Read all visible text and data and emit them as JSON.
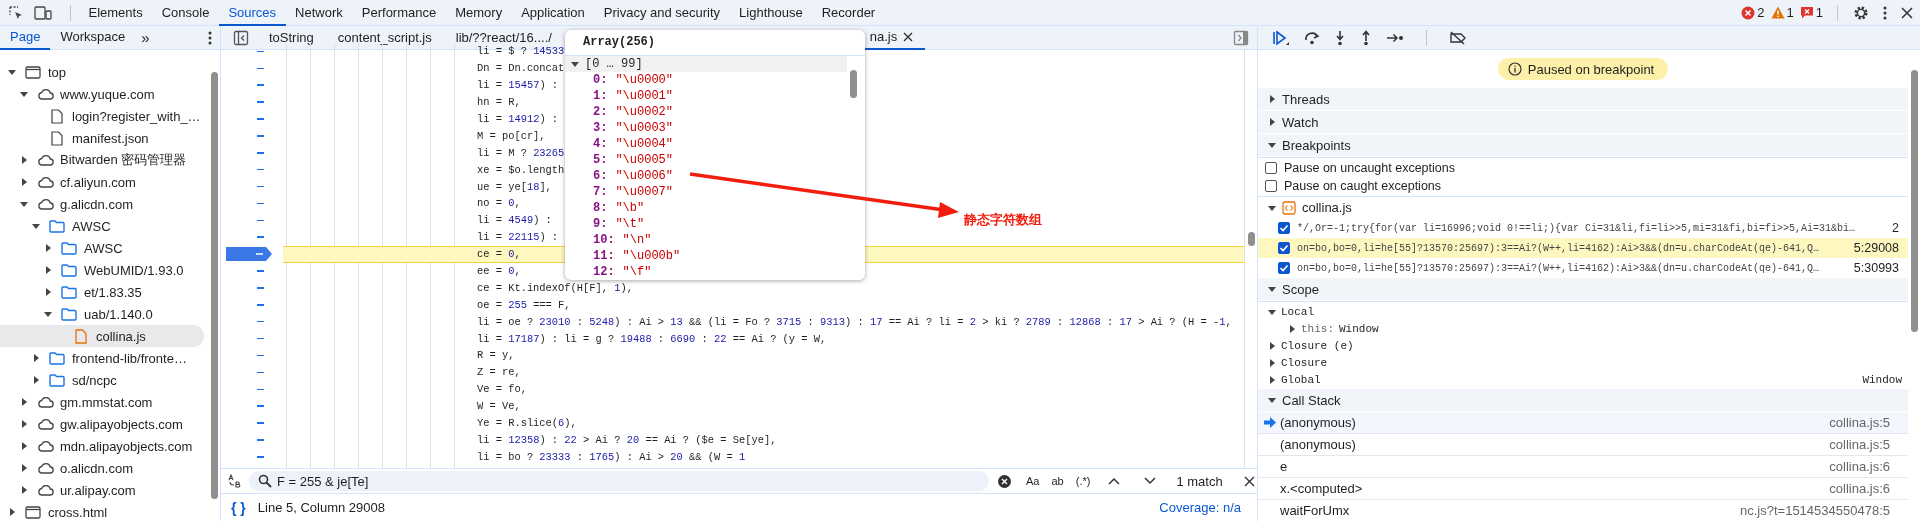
{
  "devtools_tabs": [
    {
      "label": "Elements",
      "selected": false
    },
    {
      "label": "Console",
      "selected": false
    },
    {
      "label": "Sources",
      "selected": true
    },
    {
      "label": "Network",
      "selected": false
    },
    {
      "label": "Performance",
      "selected": false
    },
    {
      "label": "Memory",
      "selected": false
    },
    {
      "label": "Application",
      "selected": false
    },
    {
      "label": "Privacy and security",
      "selected": false
    },
    {
      "label": "Lighthouse",
      "selected": false
    },
    {
      "label": "Recorder",
      "selected": false
    }
  ],
  "issue_counts": {
    "errors": "2",
    "warnings": "1",
    "issues": "1"
  },
  "navigator_tabs": [
    {
      "label": "Page",
      "selected": true
    },
    {
      "label": "Workspace",
      "selected": false
    }
  ],
  "more_tabs": "»",
  "file_tree": [
    {
      "label": "top",
      "kind": "frame",
      "expanded": true,
      "selected": false,
      "children": [
        {
          "label": "www.yuque.com",
          "kind": "domain",
          "expanded": true,
          "selected": false,
          "children": [
            {
              "label": "login?register_with_…",
              "kind": "file",
              "selected": false
            },
            {
              "label": "manifest.json",
              "kind": "file",
              "selected": false
            }
          ]
        },
        {
          "label": "Bitwarden 密码管理器",
          "kind": "domain",
          "expanded": false,
          "selected": false
        },
        {
          "label": "cf.aliyun.com",
          "kind": "domain",
          "expanded": false,
          "selected": false
        },
        {
          "label": "g.alicdn.com",
          "kind": "domain",
          "expanded": true,
          "selected": false,
          "children": [
            {
              "label": "AWSC",
              "kind": "folder",
              "expanded": true,
              "selected": false,
              "children": [
                {
                  "label": "AWSC",
                  "kind": "folder",
                  "expanded": false,
                  "selected": false
                },
                {
                  "label": "WebUMID/1.93.0",
                  "kind": "folder",
                  "expanded": false,
                  "selected": false
                },
                {
                  "label": "et/1.83.35",
                  "kind": "folder",
                  "expanded": false,
                  "selected": false
                },
                {
                  "label": "uab/1.140.0",
                  "kind": "folder",
                  "expanded": true,
                  "selected": false,
                  "children": [
                    {
                      "label": "collina.js",
                      "kind": "script",
                      "selected": true
                    }
                  ]
                }
              ]
            },
            {
              "label": "frontend-lib/fronte…",
              "kind": "folder",
              "expanded": false,
              "selected": false
            },
            {
              "label": "sd/ncpc",
              "kind": "folder",
              "expanded": false,
              "selected": false
            }
          ]
        },
        {
          "label": "gm.mmstat.com",
          "kind": "domain",
          "expanded": false,
          "selected": false
        },
        {
          "label": "gw.alipayobjects.com",
          "kind": "domain",
          "expanded": false,
          "selected": false
        },
        {
          "label": "mdn.alipayobjects.com",
          "kind": "domain",
          "expanded": false,
          "selected": false
        },
        {
          "label": "o.alicdn.com",
          "kind": "domain",
          "expanded": false,
          "selected": false
        },
        {
          "label": "ur.alipay.com",
          "kind": "domain",
          "expanded": false,
          "selected": false
        }
      ]
    },
    {
      "label": "cross.html",
      "kind": "frame",
      "expanded": false,
      "selected": false
    }
  ],
  "editor_tabs": [
    {
      "label": "toString",
      "selected": false
    },
    {
      "label": "content_script.js",
      "selected": false
    },
    {
      "label": "lib/??react/16..../",
      "selected": false
    },
    {
      "label": "na.js",
      "selected": true
    }
  ],
  "code_lines": [
    {
      "text": "li = $ ? 14533",
      "breakpoint": false
    },
    {
      "text": "Dn = Dn.concat",
      "breakpoint": false
    },
    {
      "text": "li = 15457) :",
      "breakpoint": false
    },
    {
      "text": "hn = R,",
      "breakpoint": false
    },
    {
      "text": "li = 14912) :",
      "breakpoint": false
    },
    {
      "text": "M = po[cr],",
      "breakpoint": false
    },
    {
      "text": "li = M ? 23265",
      "breakpoint": false
    },
    {
      "text": "xe = $o.length",
      "breakpoint": false
    },
    {
      "text": "ue = ye[18],",
      "breakpoint": false
    },
    {
      "text": "no = 0,",
      "breakpoint": false
    },
    {
      "text": "li = 4549) :",
      "breakpoint": false
    },
    {
      "text": "li = 22115) :",
      "breakpoint": false
    },
    {
      "text": "ce = 0,",
      "breakpoint": true
    },
    {
      "text": "ee = 0,",
      "breakpoint": false
    },
    {
      "text": "ce = Kt.indexOf(H[F], 1),",
      "breakpoint": false
    },
    {
      "text": "oe = 255 === F,",
      "breakpoint": false
    },
    {
      "text": "li = oe ? 23010 : 5248) : Ai > 13 && (li = Fo ? 3715 : 9313) : 17 == Ai ? li = 2 > ki ? 2789 : 12868 : 17 > Ai ? (H = -1,",
      "breakpoint": false
    },
    {
      "text": "li = 17187) : li = g ? 19488 : 6690 : 22 == Ai ? (y = W,",
      "breakpoint": false
    },
    {
      "text": "R = y,",
      "breakpoint": false
    },
    {
      "text": "Z = re,",
      "breakpoint": false
    },
    {
      "text": "Ve = fo,",
      "breakpoint": false
    },
    {
      "text": "W = Ve,",
      "breakpoint": false
    },
    {
      "text": "Ye = R.slice(6),",
      "breakpoint": false
    },
    {
      "text": "li = 12358) : 22 > Ai ? 20 == Ai ? ($e = Se[ye],",
      "breakpoint": false
    },
    {
      "text": "li = bo ? 23333 : 1765) : Ai > 20 && (W = 1",
      "breakpoint": false
    }
  ],
  "hover_popup": {
    "title": "Array(256)",
    "group": "[0 … 99]",
    "expanded": true,
    "entries": [
      {
        "key": "0:",
        "value": "\"\\u0000\""
      },
      {
        "key": "1:",
        "value": "\"\\u0001\""
      },
      {
        "key": "2:",
        "value": "\"\\u0002\""
      },
      {
        "key": "3:",
        "value": "\"\\u0003\""
      },
      {
        "key": "4:",
        "value": "\"\\u0004\""
      },
      {
        "key": "5:",
        "value": "\"\\u0005\""
      },
      {
        "key": "6:",
        "value": "\"\\u0006\""
      },
      {
        "key": "7:",
        "value": "\"\\u0007\""
      },
      {
        "key": "8:",
        "value": "\"\\b\""
      },
      {
        "key": "9:",
        "value": "\"\\t\""
      },
      {
        "key": "10:",
        "value": "\"\\n\""
      },
      {
        "key": "11:",
        "value": "\"\\u000b\""
      },
      {
        "key": "12:",
        "value": "\"\\f\""
      }
    ]
  },
  "annotation": {
    "text": "静态字符数组"
  },
  "search": {
    "value": "F = 255 & je[Te]",
    "toggles": [
      "Aa",
      "ab",
      "(.*)"
    ],
    "result": "1 match"
  },
  "status_bar": {
    "format_button": "{ }",
    "position": "Line 5, Column 29008",
    "coverage": "Coverage: n/a"
  },
  "debugger": {
    "banner": "Paused on breakpoint",
    "threads": {
      "title": "Threads",
      "expanded": false
    },
    "watch": {
      "title": "Watch",
      "expanded": false
    },
    "breakpoints": {
      "title": "Breakpoints",
      "expanded": true,
      "options": [
        {
          "label": "Pause on uncaught exceptions",
          "checked": false
        },
        {
          "label": "Pause on caught exceptions",
          "checked": false
        }
      ],
      "file": {
        "name": "collina.js",
        "expanded": true
      },
      "items": [
        {
          "code": "*/,Or=-1;try{for(var li=16996;void 0!==li;){var Ci=31&li,fi=li>>5,mi=31&fi,bi=fi>>5,Ai=31&bi…",
          "location": "2",
          "checked": true,
          "selected": false
        },
        {
          "code": "on=bo,bo=0,li=he[55]?13570:25697):3==Ai?(W++,li=4162):Ai>3&&(dn=u.charCodeAt(qe)-641,Q…",
          "location": "5:29008",
          "checked": true,
          "selected": true
        },
        {
          "code": "on=bo,bo=0,li=he[55]?13570:25697):3==Ai?(W++,li=4162):Ai>3&&(dn=u.charCodeAt(qe)-641,Q…",
          "location": "5:30993",
          "checked": true,
          "selected": false
        }
      ]
    },
    "scope": {
      "title": "Scope",
      "expanded": true,
      "items": [
        {
          "name": "Local",
          "expanded": true,
          "children": [
            {
              "name": "this:",
              "value": "Window",
              "expanded": false
            }
          ]
        },
        {
          "name": "Closure (e)",
          "expanded": false
        },
        {
          "name": "Closure",
          "expanded": false
        },
        {
          "name": "Global",
          "value": "Window",
          "expanded": false
        }
      ]
    },
    "call_stack": {
      "title": "Call Stack",
      "expanded": true,
      "frames": [
        {
          "name": "(anonymous)",
          "location": "collina.js:5",
          "selected": true
        },
        {
          "name": "(anonymous)",
          "location": "collina.js:5",
          "selected": false
        },
        {
          "name": "e",
          "location": "collina.js:6",
          "selected": false
        },
        {
          "name": "x.<computed>",
          "location": "collina.js:6",
          "selected": false
        },
        {
          "name": "waitForUmx",
          "location": "nc.js?t=1514534550478:5",
          "selected": false
        }
      ]
    }
  }
}
